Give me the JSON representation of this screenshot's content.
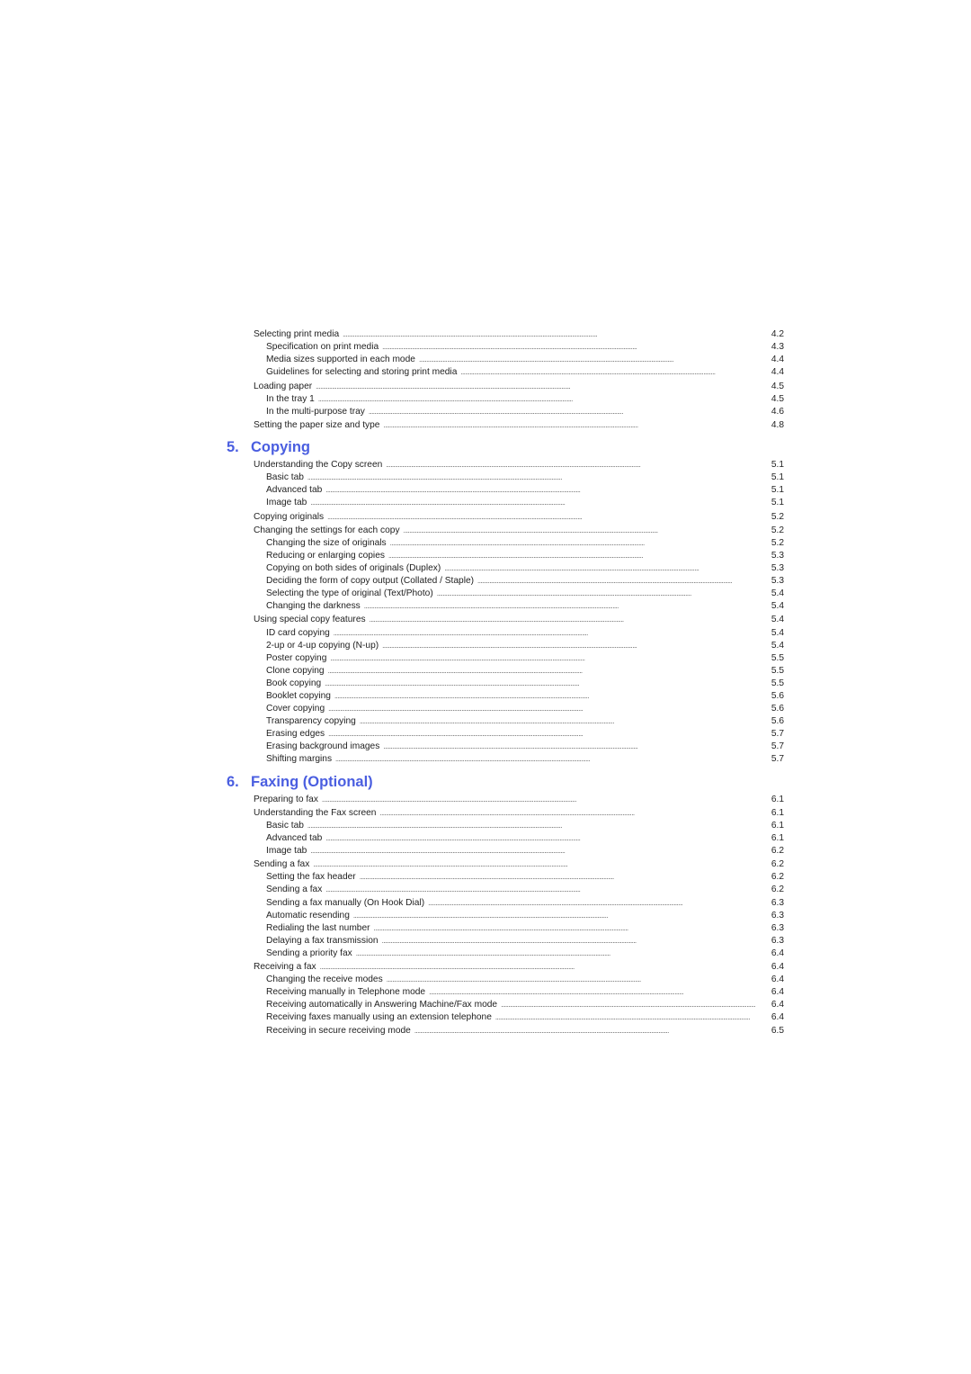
{
  "toc_continued": [
    {
      "label": "Selecting print media",
      "page": "4.2",
      "level": 1
    },
    {
      "label": "Specification on print media",
      "page": "4.3",
      "level": 2
    },
    {
      "label": "Media sizes supported in each mode",
      "page": "4.4",
      "level": 2
    },
    {
      "label": "Guidelines for selecting and storing print media",
      "page": "4.4",
      "level": 2
    },
    {
      "label": "Loading paper",
      "page": "4.5",
      "level": 1
    },
    {
      "label": "In the tray 1",
      "page": "4.5",
      "level": 2
    },
    {
      "label": "In the multi-purpose tray",
      "page": "4.6",
      "level": 2
    },
    {
      "label": "Setting the paper size and type",
      "page": "4.8",
      "level": 1
    }
  ],
  "chapters": [
    {
      "number": "5.",
      "title": "Copying",
      "entries": [
        {
          "label": "Understanding the Copy screen",
          "page": "5.1",
          "level": 1
        },
        {
          "label": "Basic tab",
          "page": "5.1",
          "level": 2
        },
        {
          "label": "Advanced tab",
          "page": "5.1",
          "level": 2
        },
        {
          "label": "Image tab",
          "page": "5.1",
          "level": 2
        },
        {
          "label": "Copying originals",
          "page": "5.2",
          "level": 1
        },
        {
          "label": "Changing the settings for each copy",
          "page": "5.2",
          "level": 1
        },
        {
          "label": "Changing the size of originals",
          "page": "5.2",
          "level": 2
        },
        {
          "label": "Reducing or enlarging copies",
          "page": "5.3",
          "level": 2
        },
        {
          "label": "Copying on both sides of originals (Duplex)",
          "page": "5.3",
          "level": 2
        },
        {
          "label": "Deciding the form of copy output (Collated / Staple)",
          "page": "5.3",
          "level": 2
        },
        {
          "label": "Selecting the type of original (Text/Photo)",
          "page": "5.4",
          "level": 2
        },
        {
          "label": "Changing the darkness",
          "page": "5.4",
          "level": 2
        },
        {
          "label": "Using special copy features",
          "page": "5.4",
          "level": 1
        },
        {
          "label": "ID card copying",
          "page": "5.4",
          "level": 2
        },
        {
          "label": "2-up or 4-up copying (N-up)",
          "page": "5.4",
          "level": 2
        },
        {
          "label": "Poster copying",
          "page": "5.5",
          "level": 2
        },
        {
          "label": "Clone copying",
          "page": "5.5",
          "level": 2
        },
        {
          "label": "Book copying",
          "page": "5.5",
          "level": 2
        },
        {
          "label": "Booklet copying",
          "page": "5.6",
          "level": 2
        },
        {
          "label": "Cover copying",
          "page": "5.6",
          "level": 2
        },
        {
          "label": "Transparency copying",
          "page": "5.6",
          "level": 2
        },
        {
          "label": "Erasing edges",
          "page": "5.7",
          "level": 2
        },
        {
          "label": "Erasing background images",
          "page": "5.7",
          "level": 2
        },
        {
          "label": "Shifting margins",
          "page": "5.7",
          "level": 2
        }
      ]
    },
    {
      "number": "6.",
      "title": "Faxing (Optional)",
      "entries": [
        {
          "label": "Preparing to fax",
          "page": "6.1",
          "level": 1
        },
        {
          "label": "Understanding the Fax screen",
          "page": "6.1",
          "level": 1
        },
        {
          "label": "Basic tab",
          "page": "6.1",
          "level": 2
        },
        {
          "label": "Advanced tab",
          "page": "6.1",
          "level": 2
        },
        {
          "label": "Image tab",
          "page": "6.2",
          "level": 2
        },
        {
          "label": "Sending a fax",
          "page": "6.2",
          "level": 1
        },
        {
          "label": "Setting the fax header",
          "page": "6.2",
          "level": 2
        },
        {
          "label": "Sending a fax",
          "page": "6.2",
          "level": 2
        },
        {
          "label": "Sending a fax manually (On Hook Dial)",
          "page": "6.3",
          "level": 2
        },
        {
          "label": "Automatic resending",
          "page": "6.3",
          "level": 2
        },
        {
          "label": "Redialing the last number",
          "page": "6.3",
          "level": 2
        },
        {
          "label": "Delaying a fax transmission",
          "page": "6.3",
          "level": 2
        },
        {
          "label": "Sending a priority fax",
          "page": "6.4",
          "level": 2
        },
        {
          "label": "Receiving a fax",
          "page": "6.4",
          "level": 1
        },
        {
          "label": "Changing the receive modes",
          "page": "6.4",
          "level": 2
        },
        {
          "label": "Receiving manually in Telephone mode",
          "page": "6.4",
          "level": 2
        },
        {
          "label": "Receiving automatically in Answering Machine/Fax mode",
          "page": "6.4",
          "level": 2
        },
        {
          "label": "Receiving faxes manually using an extension telephone",
          "page": "6.4",
          "level": 2
        },
        {
          "label": "Receiving in secure receiving mode",
          "page": "6.5",
          "level": 2
        }
      ]
    }
  ],
  "colors": {
    "heading": "#4a5ee0",
    "text": "#222222"
  }
}
